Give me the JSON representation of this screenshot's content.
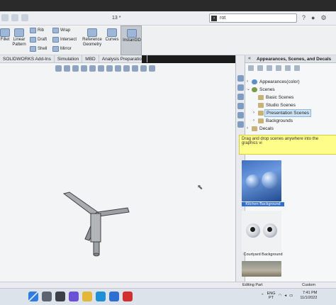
{
  "titlebar": {
    "doc_title": "13 *",
    "search_text": "rot",
    "search_icon": "terminal-prompt-icon",
    "right_icons": [
      "help-icon",
      "user-icon",
      "settings-icon"
    ]
  },
  "ribbon": {
    "fillet": "Fillet",
    "linear_pattern": "Linear Pattern",
    "rib": "Rib",
    "draft": "Draft",
    "shell": "Shell",
    "wrap": "Wrap",
    "intersect": "Intersect",
    "mirror": "Mirror",
    "reference_geometry": "Reference Geometry",
    "curves": "Curves",
    "instant3d": "Instant3D"
  },
  "tabs": [
    "SOLIDWORKS Add-Ins",
    "Simulation",
    "MBD",
    "Analysis Preparation"
  ],
  "task_pane": {
    "title": "Appearances, Scenes, and Decals",
    "tree": [
      {
        "label": "Appearances(color)",
        "twisty": "›",
        "icon": "globe",
        "indent": 0
      },
      {
        "label": "Scenes",
        "twisty": "⌄",
        "icon": "scene",
        "indent": 0
      },
      {
        "label": "Basic Scenes",
        "twisty": "",
        "icon": "folder",
        "indent": 1
      },
      {
        "label": "Studio Scenes",
        "twisty": "",
        "icon": "folder",
        "indent": 1
      },
      {
        "label": "Presentation Scenes",
        "twisty": "›",
        "icon": "folder",
        "indent": 1,
        "selected": true
      },
      {
        "label": "Backgrounds",
        "twisty": "›",
        "icon": "folder",
        "indent": 1
      },
      {
        "label": "Decals",
        "twisty": "›",
        "icon": "folder",
        "indent": 0
      }
    ],
    "tip": "Drag and drop scenes anywhere into the graphics vi",
    "thumbnails": [
      {
        "label": "Kitchen Background",
        "selected": true
      },
      {
        "label": "Courtyard Background",
        "selected": false
      },
      {
        "label": "",
        "selected": false
      }
    ]
  },
  "statusbar": {
    "mode": "Editing Part",
    "units": "Custom"
  },
  "taskbar": {
    "lang": "ENG",
    "region": "PT",
    "time": "7:41 PM",
    "date": "11/1/2022"
  }
}
